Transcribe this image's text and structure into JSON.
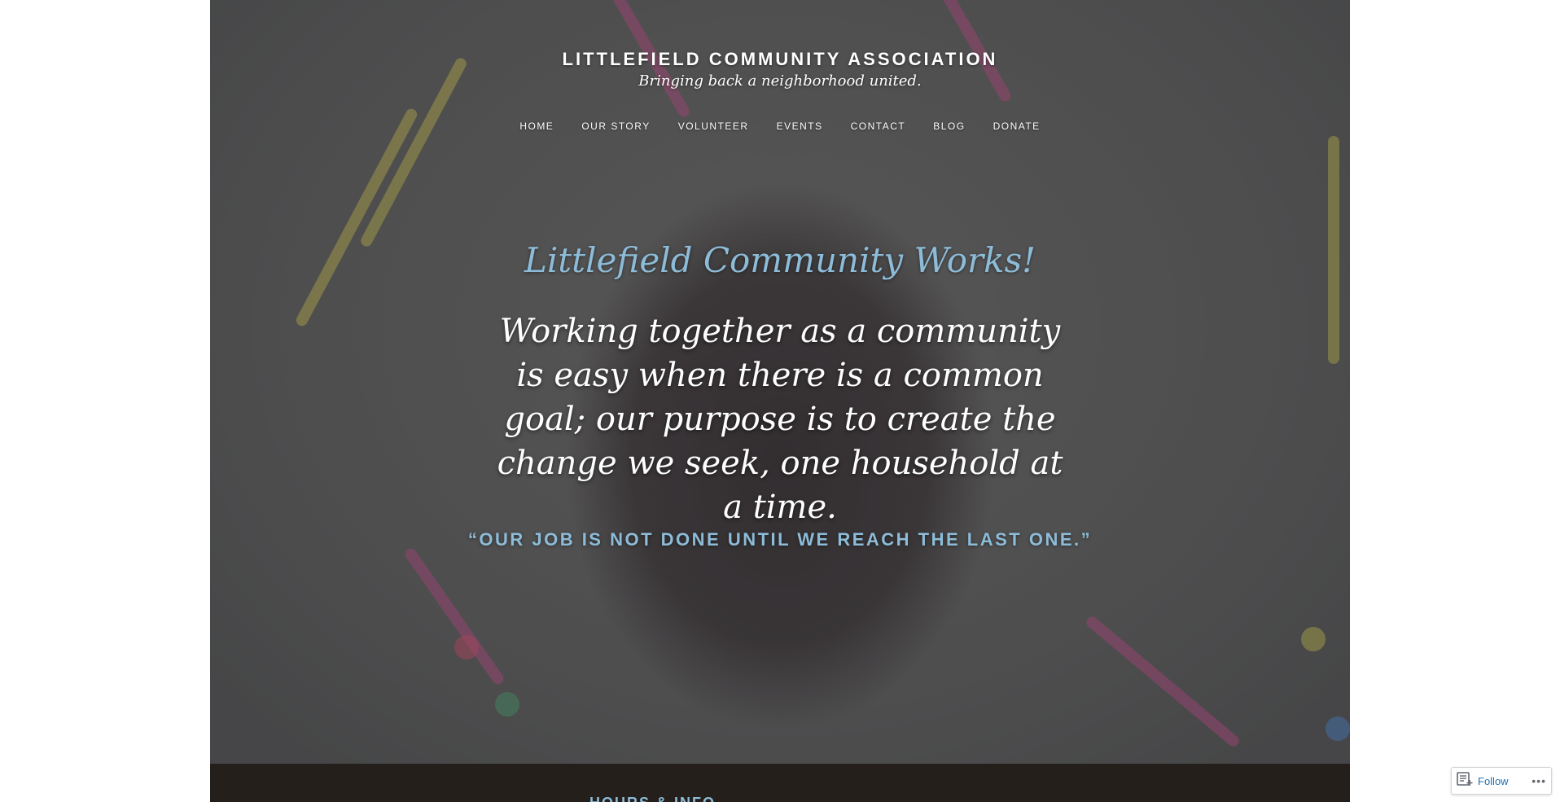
{
  "site": {
    "title": "LITTLEFIELD COMMUNITY ASSOCIATION",
    "tagline": "Bringing back a neighborhood united."
  },
  "nav": {
    "items": [
      {
        "label": "HOME"
      },
      {
        "label": "OUR STORY"
      },
      {
        "label": "VOLUNTEER"
      },
      {
        "label": "EVENTS"
      },
      {
        "label": "CONTACT"
      },
      {
        "label": "BLOG"
      },
      {
        "label": "DONATE"
      }
    ]
  },
  "hero": {
    "headline": "Littlefield Community Works!",
    "mission": "Working together as a community is easy when there is a common goal; our purpose is to create the change we seek, one household at a time.",
    "quote": "“OUR JOB IS NOT DONE UNTIL WE REACH THE LAST ONE.”"
  },
  "footer": {
    "section_title": "HOURS & INFO"
  },
  "follow_widget": {
    "label": "Follow",
    "more_label": "•••"
  },
  "colors": {
    "accent": "#8dbcd8",
    "footer_band": "#241f1b",
    "link": "#2271b1"
  },
  "icons": {
    "follow": "wordpress-reader-icon",
    "more": "ellipsis-icon"
  }
}
